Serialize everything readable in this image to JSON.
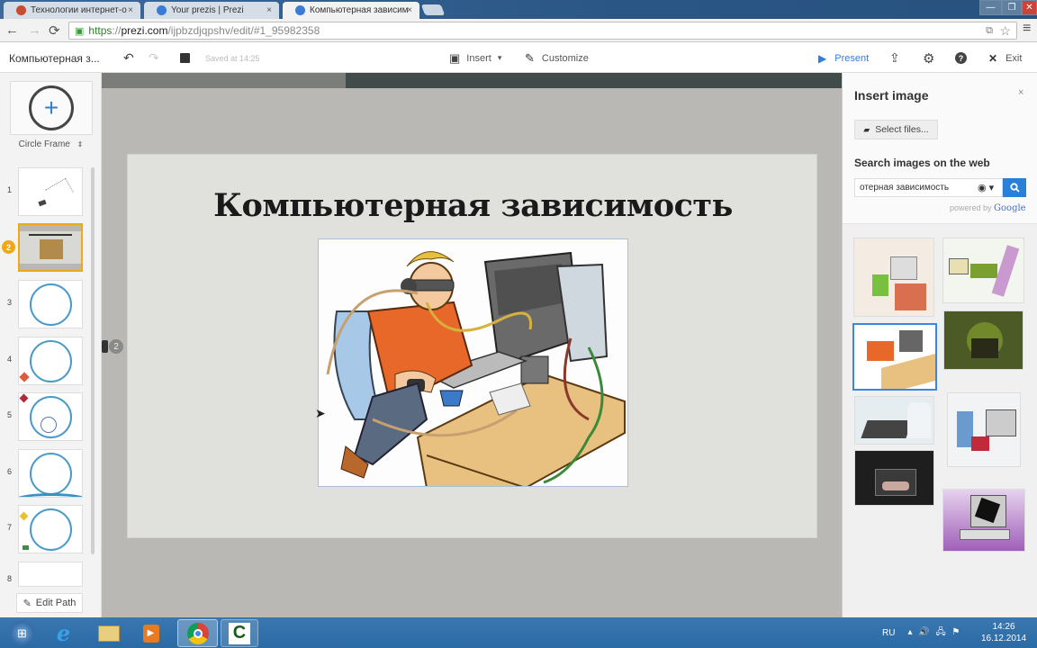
{
  "browser": {
    "tabs": [
      {
        "title": "Технологии интернет-о",
        "active": false,
        "favicon_color": "#c84b2e"
      },
      {
        "title": "Your prezis | Prezi",
        "active": false,
        "favicon_color": "#3a7bd5"
      },
      {
        "title": "Компьютерная зависимс",
        "active": true,
        "favicon_color": "#3a7bd5"
      }
    ],
    "url": {
      "scheme": "https",
      "separator": "://",
      "host": "prezi.com",
      "path": "/ijpbzdjqpshv/edit/#1_95982358"
    },
    "icons": {
      "back": "←",
      "forward": "→",
      "reload": "⟳",
      "lock": "🔒",
      "star": "☆",
      "menu": "≡",
      "translate": "⧉",
      "tab_close": "×"
    },
    "window_controls": {
      "minimize": "—",
      "restore": "❐",
      "close": "✕"
    }
  },
  "toolbar": {
    "doc_title": "Компьютерная з...",
    "saved_status": "Saved at 14:25",
    "insert_label": "Insert",
    "customize_label": "Customize",
    "present_label": "Present",
    "exit_label": "Exit",
    "icons": {
      "undo": "↶",
      "redo": "↷",
      "save": "💾",
      "insert": "▣",
      "caret": "▾",
      "brush": "✎",
      "play": "▶",
      "share": "⇪",
      "settings": "⚙",
      "help": "?",
      "close": "✕"
    }
  },
  "sidebar": {
    "add_frame_icon": "+",
    "frame_type": "Circle Frame",
    "frame_type_caret": "⇕",
    "slides": [
      {
        "number": "1",
        "kind": "overview"
      },
      {
        "number": "2",
        "kind": "title-slide",
        "selected": true
      },
      {
        "number": "3",
        "kind": "circle"
      },
      {
        "number": "4",
        "kind": "circle"
      },
      {
        "number": "5",
        "kind": "circle"
      },
      {
        "number": "6",
        "kind": "circle"
      },
      {
        "number": "7",
        "kind": "circle"
      },
      {
        "number": "8",
        "kind": "overview"
      }
    ],
    "edit_path_label": "Edit Path",
    "edit_path_icon": "✎"
  },
  "canvas": {
    "progress_fraction": 0.33,
    "slide_title": "Компьютерная зависимость",
    "path_marker": "2",
    "image_description": "Cartoon: boy wired to computer with VR goggles"
  },
  "insert_panel": {
    "title": "Insert image",
    "close_icon": "×",
    "select_files_label": "Select files...",
    "select_files_icon": "▰",
    "search_heading": "Search images on the web",
    "search_value": "отерная зависимость",
    "globe_icon": "◉ ▾",
    "search_icon": "🔍",
    "powered_by": "powered by",
    "powered_brand": "Google",
    "results": [
      {
        "desc": "boy at desk cartoon",
        "color": "#e9ddd0"
      },
      {
        "desc": "girl pulling boy from computer",
        "color": "#e8efe0"
      },
      {
        "desc": "boy wired to computer",
        "color": "#d9c9a0",
        "selected": true
      },
      {
        "desc": "dark green figure at computer",
        "color": "#4c5a25"
      },
      {
        "desc": "boy on laptop photo",
        "color": "#cdd7de"
      },
      {
        "desc": "woman pulling man out of monitor",
        "color": "#e4e7ea"
      },
      {
        "desc": "hands on laptop dark",
        "color": "#1e1e1e"
      },
      {
        "desc": "broken monitor purple",
        "color": "#b077c0"
      }
    ]
  },
  "taskbar": {
    "apps": [
      {
        "name": "start",
        "glyph": "⊞"
      },
      {
        "name": "internet-explorer",
        "glyph": "e"
      },
      {
        "name": "file-explorer",
        "glyph": "▤"
      },
      {
        "name": "media-player",
        "glyph": "▶"
      },
      {
        "name": "chrome",
        "glyph": "◉",
        "active": true
      },
      {
        "name": "camtasia",
        "glyph": "C"
      }
    ],
    "language": "RU",
    "tray_icons": "▴  🔊  🖧  ⚑",
    "time": "14:26",
    "date": "16.12.2014"
  }
}
